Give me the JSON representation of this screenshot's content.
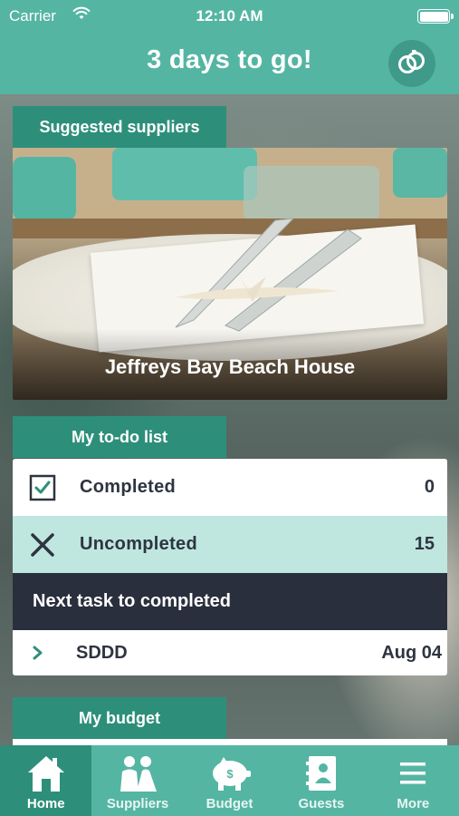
{
  "status_bar": {
    "carrier": "Carrier",
    "time": "12:10 AM"
  },
  "header": {
    "title": "3 days to go!",
    "icon": "wedding-rings-icon"
  },
  "suggested_suppliers": {
    "section_label": "Suggested suppliers",
    "featured_name": "Jeffreys Bay Beach House"
  },
  "todo": {
    "section_label": "My to-do list",
    "completed_label": "Completed",
    "completed_count": "0",
    "uncompleted_label": "Uncompleted",
    "uncompleted_count": "15",
    "next_task_header": "Next task to completed",
    "next_task_name": "SDDD",
    "next_task_date": "Aug 04"
  },
  "budget": {
    "section_label": "My budget"
  },
  "tabbar": {
    "items": [
      {
        "label": "Home",
        "icon": "home-icon",
        "active": true
      },
      {
        "label": "Suppliers",
        "icon": "couple-icon",
        "active": false
      },
      {
        "label": "Budget",
        "icon": "piggy-bank-icon",
        "active": false
      },
      {
        "label": "Guests",
        "icon": "address-book-icon",
        "active": false
      },
      {
        "label": "More",
        "icon": "menu-icon",
        "active": false
      }
    ]
  },
  "colors": {
    "primary": "#55b5a3",
    "accent_dark": "#2d8f7a",
    "highlight_row": "#bfe7df",
    "dark_bar": "#2a2f3d"
  }
}
